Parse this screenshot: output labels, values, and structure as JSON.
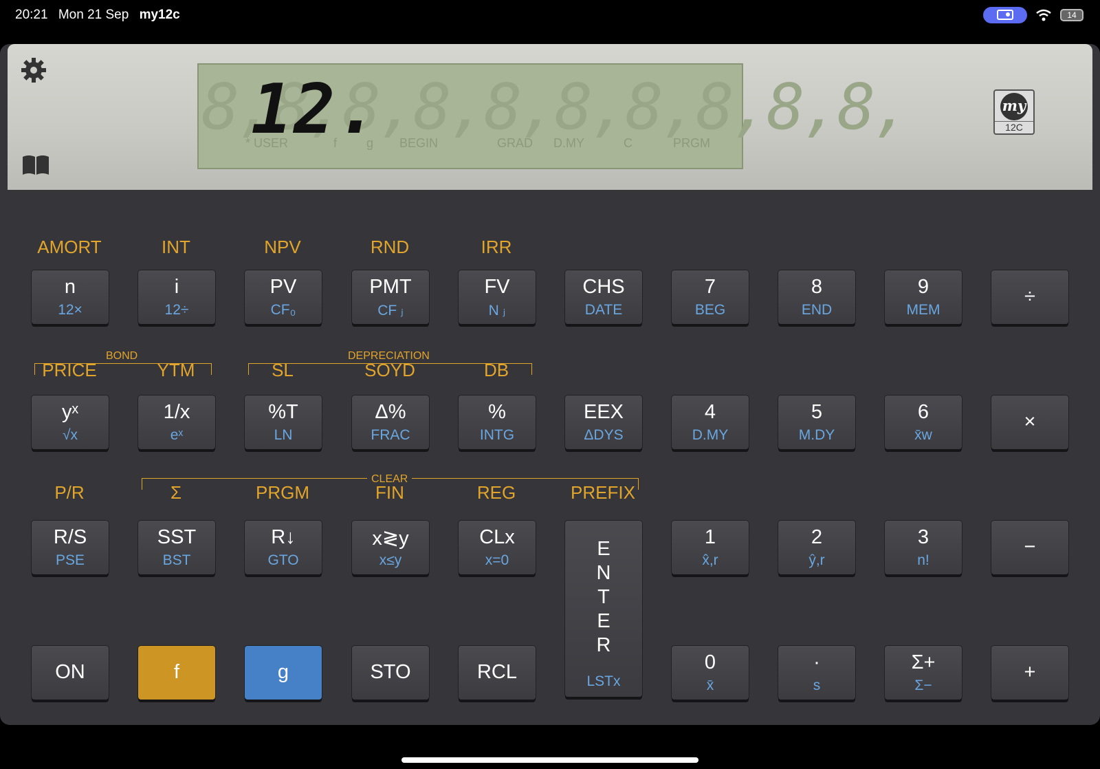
{
  "status": {
    "time": "20:21",
    "date": "Mon 21 Sep",
    "app": "my12c",
    "battery": "14"
  },
  "display": {
    "value": "12.",
    "ghost": "8,8,8,8,8,8,8,8,8,8,",
    "indicators": [
      "* USER",
      "f",
      "g",
      "BEGIN",
      "GRAD",
      "D.MY",
      "C",
      "PRGM"
    ]
  },
  "logo": {
    "text": "my",
    "number": "12C"
  },
  "f_labels": {
    "row1": [
      "AMORT",
      "INT",
      "NPV",
      "RND",
      "IRR"
    ],
    "row2": [
      "PRICE",
      "YTM",
      "SL",
      "SOYD",
      "DB"
    ],
    "row3": [
      "P/R",
      "Σ",
      "PRGM",
      "FIN",
      "REG",
      "PREFIX"
    ]
  },
  "groups": {
    "bond": "BOND",
    "depreciation": "DEPRECIATION",
    "clear": "CLEAR"
  },
  "keys": {
    "row1": [
      {
        "main": "n",
        "sub": "12×"
      },
      {
        "main": "i",
        "sub": "12÷"
      },
      {
        "main": "PV",
        "sub": "CF₀"
      },
      {
        "main": "PMT",
        "sub": "CF ⱼ"
      },
      {
        "main": "FV",
        "sub": "N ⱼ"
      },
      {
        "main": "CHS",
        "sub": "DATE"
      },
      {
        "main": "7",
        "sub": "BEG"
      },
      {
        "main": "8",
        "sub": "END"
      },
      {
        "main": "9",
        "sub": "MEM"
      },
      {
        "main": "÷",
        "sub": ""
      }
    ],
    "row2": [
      {
        "main": "yˣ",
        "sub": "√x"
      },
      {
        "main": "1/x",
        "sub": "eˣ"
      },
      {
        "main": "%T",
        "sub": "LN"
      },
      {
        "main": "Δ%",
        "sub": "FRAC"
      },
      {
        "main": "%",
        "sub": "INTG"
      },
      {
        "main": "EEX",
        "sub": "ΔDYS"
      },
      {
        "main": "4",
        "sub": "D.MY"
      },
      {
        "main": "5",
        "sub": "M.DY"
      },
      {
        "main": "6",
        "sub": "x̄w"
      },
      {
        "main": "×",
        "sub": ""
      }
    ],
    "row3": [
      {
        "main": "R/S",
        "sub": "PSE"
      },
      {
        "main": "SST",
        "sub": "BST"
      },
      {
        "main": "R↓",
        "sub": "GTO"
      },
      {
        "main": "x≷y",
        "sub": "x≤y"
      },
      {
        "main": "CLx",
        "sub": "x=0"
      },
      {
        "main": "1",
        "sub": "x̂,r"
      },
      {
        "main": "2",
        "sub": "ŷ,r"
      },
      {
        "main": "3",
        "sub": "n!"
      },
      {
        "main": "−",
        "sub": ""
      }
    ],
    "row4": [
      {
        "main": "ON",
        "sub": ""
      },
      {
        "main": "f",
        "sub": ""
      },
      {
        "main": "g",
        "sub": ""
      },
      {
        "main": "STO",
        "sub": ""
      },
      {
        "main": "RCL",
        "sub": ""
      },
      {
        "main": "0",
        "sub": "x̄"
      },
      {
        "main": "·",
        "sub": "s"
      },
      {
        "main": "Σ+",
        "sub": "Σ−"
      },
      {
        "main": "+",
        "sub": ""
      }
    ],
    "enter": {
      "letters": [
        "E",
        "N",
        "T",
        "E",
        "R"
      ],
      "sub": "LSTx"
    }
  }
}
